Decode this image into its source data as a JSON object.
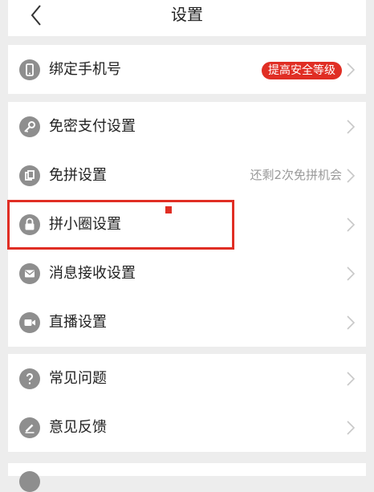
{
  "header": {
    "title": "设置",
    "back_icon": "chevron-left-icon"
  },
  "groups": [
    {
      "items": [
        {
          "label": "绑定手机号",
          "icon": "phone-icon",
          "badge": "提高安全等级"
        }
      ]
    },
    {
      "items": [
        {
          "label": "免密支付设置",
          "icon": "key-icon"
        },
        {
          "label": "免拼设置",
          "icon": "coupon-icon",
          "hint": "还剩2次免拼机会"
        },
        {
          "label": "拼小圈设置",
          "icon": "lock-icon",
          "highlighted": true
        },
        {
          "label": "消息接收设置",
          "icon": "envelope-icon"
        },
        {
          "label": "直播设置",
          "icon": "video-camera-icon"
        }
      ]
    },
    {
      "items": [
        {
          "label": "常见问题",
          "icon": "question-icon"
        },
        {
          "label": "意见反馈",
          "icon": "pencil-icon"
        }
      ]
    }
  ],
  "colors": {
    "accent": "#e02e24",
    "icon_gray": "#8e8e8e",
    "background": "#ededed",
    "hint_text": "#9a9a9a"
  }
}
